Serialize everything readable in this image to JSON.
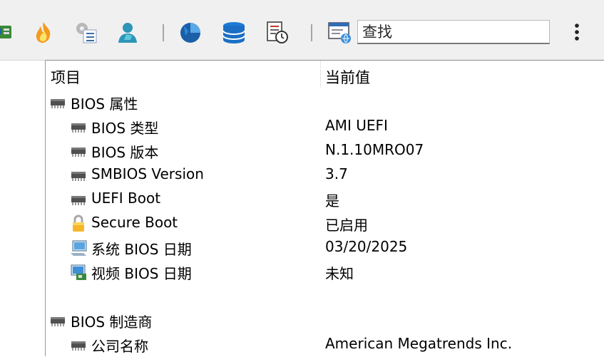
{
  "toolbar": {
    "icons": [
      "motherboard-icon",
      "overclock-flame-icon",
      "settings-checklist-icon",
      "user-account-icon",
      "disk-pie-icon",
      "database-icon",
      "schedule-report-icon",
      "network-monitor-icon"
    ],
    "search_placeholder": "查找",
    "more_glyph": "⋮"
  },
  "table": {
    "header": {
      "field": "项目",
      "value": "当前值"
    },
    "rows": [
      {
        "name": "BIOS 属性",
        "value": "",
        "icon": "chip-icon",
        "level": 0
      },
      {
        "name": "BIOS 类型",
        "value": "AMI UEFI",
        "icon": "chip-icon",
        "level": 1
      },
      {
        "name": "BIOS 版本",
        "value": "N.1.10MRO07",
        "icon": "chip-icon",
        "level": 1
      },
      {
        "name": "SMBIOS Version",
        "value": "3.7",
        "icon": "chip-icon",
        "level": 1
      },
      {
        "name": "UEFI Boot",
        "value": "是",
        "icon": "chip-icon",
        "level": 1
      },
      {
        "name": "Secure Boot",
        "value": "已启用",
        "icon": "lock-icon",
        "level": 1
      },
      {
        "name": "系统 BIOS 日期",
        "value": "03/20/2025",
        "icon": "computer-icon",
        "level": 1
      },
      {
        "name": "视频 BIOS 日期",
        "value": "未知",
        "icon": "display-card-icon",
        "level": 1
      },
      {
        "name": "BIOS 制造商",
        "value": "",
        "icon": "chip-icon",
        "level": 0
      },
      {
        "name": "公司名称",
        "value": "American Megatrends Inc.",
        "icon": "chip-icon",
        "level": 1
      }
    ]
  }
}
